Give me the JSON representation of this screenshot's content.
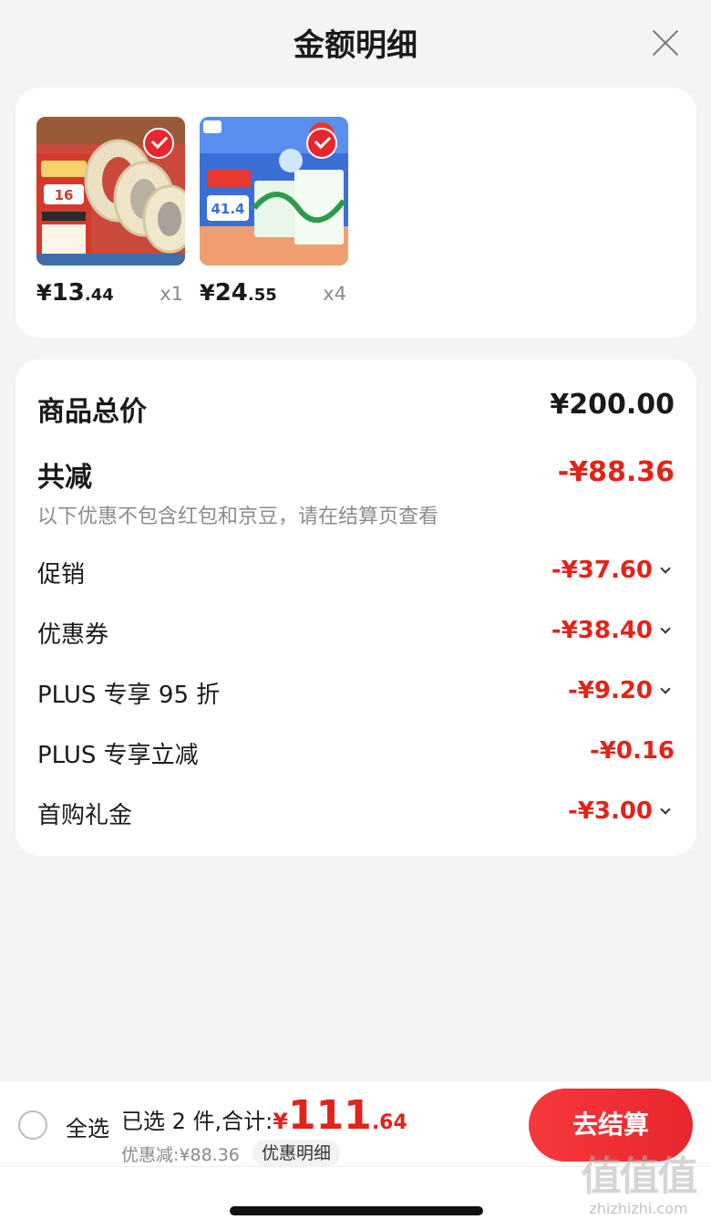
{
  "header": {
    "title": "金额明细"
  },
  "products": [
    {
      "price_yen": "¥",
      "price_int": "13",
      "price_dec": ".44",
      "quantity": "x1",
      "image": "deli-tape-thumbnail"
    },
    {
      "price_yen": "¥",
      "price_int": "24",
      "price_dec": ".55",
      "quantity": "x4",
      "image": "yili-milk-thumbnail"
    }
  ],
  "detail": {
    "goods_total_label": "商品总价",
    "goods_total_value": "¥200.00",
    "total_discount_label": "共减",
    "total_discount_value": "-¥88.36",
    "note": "以下优惠不包含红包和京豆，请在结算页查看",
    "items": [
      {
        "label": "促销",
        "value": "-¥37.60"
      },
      {
        "label": "优惠券",
        "value": "-¥38.40"
      },
      {
        "label": "PLUS 专享 95 折",
        "value": "-¥9.20"
      },
      {
        "label": "PLUS 专享立减",
        "value": "-¥0.16"
      },
      {
        "label": "首购礼金",
        "value": "-¥3.00"
      }
    ]
  },
  "bottom": {
    "select_all": "全选",
    "selected_text": "已选 2 件,合计:",
    "total_yen": "¥",
    "total_int": "111",
    "total_dec": ".64",
    "discount_text": "优惠减:¥88.36",
    "detail_link": "优惠明细",
    "checkout": "去结算"
  },
  "watermark": {
    "big": "值值值",
    "small": "zhizhizhi.com"
  },
  "colors": {
    "accent": "#e2231a",
    "button": "#e8262d"
  }
}
